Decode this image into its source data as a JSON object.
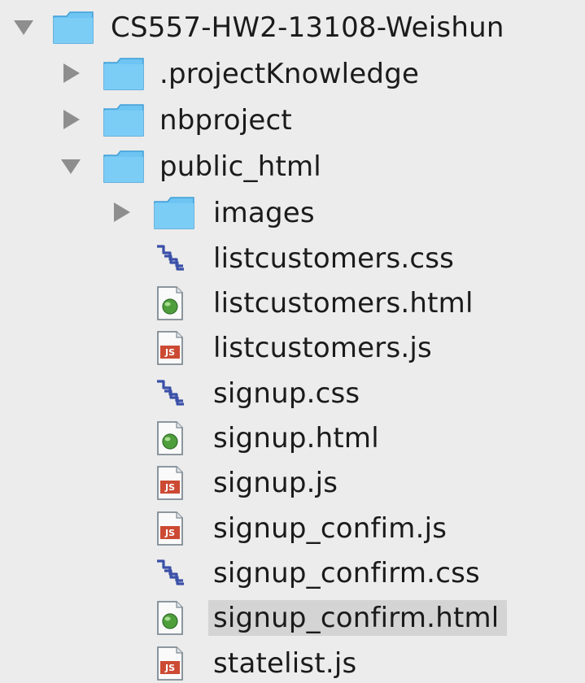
{
  "tree": {
    "root": {
      "label": "CS557-HW2-13108-Weishun",
      "icon": "folder-icon",
      "expanded": true
    },
    "folders": [
      {
        "label": ".projectKnowledge",
        "icon": "folder-icon",
        "expanded": false
      },
      {
        "label": "nbproject",
        "icon": "folder-icon",
        "expanded": false
      },
      {
        "label": "public_html",
        "icon": "folder-icon",
        "expanded": true
      }
    ],
    "public_html": {
      "images": {
        "label": "images",
        "icon": "folder-icon",
        "expanded": false
      },
      "files": [
        {
          "label": "listcustomers.css",
          "icon": "css-file-icon"
        },
        {
          "label": "listcustomers.html",
          "icon": "html-file-icon"
        },
        {
          "label": "listcustomers.js",
          "icon": "js-file-icon"
        },
        {
          "label": "signup.css",
          "icon": "css-file-icon"
        },
        {
          "label": "signup.html",
          "icon": "html-file-icon"
        },
        {
          "label": "signup.js",
          "icon": "js-file-icon"
        },
        {
          "label": "signup_confim.js",
          "icon": "js-file-icon"
        },
        {
          "label": "signup_confirm.css",
          "icon": "css-file-icon"
        },
        {
          "label": "signup_confirm.html",
          "icon": "html-file-icon",
          "selected": true
        },
        {
          "label": "statelist.js",
          "icon": "js-file-icon"
        }
      ]
    }
  },
  "colors": {
    "folder_fill": "#6ec4f2",
    "folder_stroke": "#3e9fd8",
    "disclosure": "#8e8e8e",
    "selection": "#d4d4d4",
    "js_badge": "#cc4a33",
    "html_globe": "#4f9e3c",
    "css_glyph": "#3b50a8"
  }
}
